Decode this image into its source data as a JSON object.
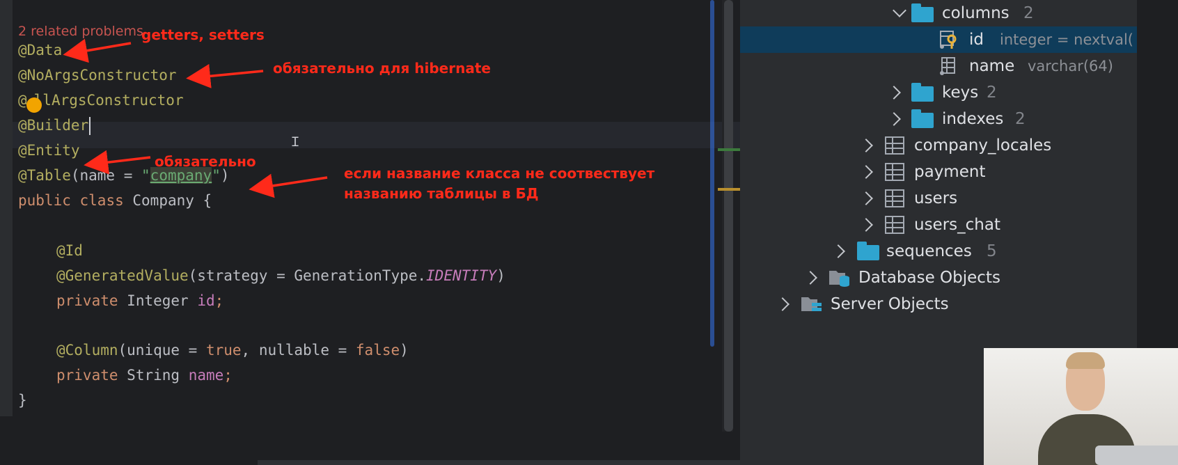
{
  "editor": {
    "problems_hint": "2 related problems",
    "lines": {
      "data": "@Data",
      "noargs": "@NoArgsConstructor",
      "allargs_prefix": "@",
      "allargs_rest": "llArgsConstructor",
      "builder": "@Builder",
      "entity": "@Entity",
      "table_ann": "@Table",
      "table_open": "(name = ",
      "table_q1": "\"",
      "table_val": "company",
      "table_q2": "\"",
      "table_close": ")",
      "class_kw1": "public",
      "class_kw2": "class",
      "class_name": "Company {",
      "id_ann": "@Id",
      "gen_ann": "@GeneratedValue",
      "gen_args": "(strategy = GenerationType.",
      "gen_const": "IDENTITY",
      "gen_close": ")",
      "id_kw": "private",
      "id_type": "Integer",
      "id_field": "id",
      "semicolon": ";",
      "col_ann": "@Column",
      "col_a1": "(unique = ",
      "col_true": "true",
      "col_a2": ", nullable = ",
      "col_false": "false",
      "col_close": ")",
      "name_kw": "private",
      "name_type": "String",
      "name_field": "name",
      "close_brace": "}"
    },
    "notes": {
      "getters_setters": "getters, setters",
      "hibernate": "обязательно для hibernate",
      "required": "обязательно",
      "table_line1": "если название класса не соотвествует",
      "table_line2": "названию таблицы в БД"
    }
  },
  "db_tree": {
    "columns": {
      "label": "columns",
      "count": "2"
    },
    "col_id": {
      "label": "id",
      "meta": "integer = nextval("
    },
    "col_name": {
      "label": "name",
      "meta": "varchar(64)"
    },
    "keys": {
      "label": "keys",
      "count": "2"
    },
    "indexes": {
      "label": "indexes",
      "count": "2"
    },
    "company_locales": "company_locales",
    "payment": "payment",
    "users": "users",
    "users_chat": "users_chat",
    "sequences": {
      "label": "sequences",
      "count": "5"
    },
    "database_objects": "Database Objects",
    "server_objects": "Server Objects"
  },
  "colors": {
    "annotation": "#b3ae60",
    "keyword": "#cf8e6d",
    "string": "#6aab73",
    "field": "#c77dbb",
    "error": "#c75450",
    "red_note": "#ff2a1a",
    "folder": "#2fa4cf",
    "selection": "#0f3c5a"
  }
}
